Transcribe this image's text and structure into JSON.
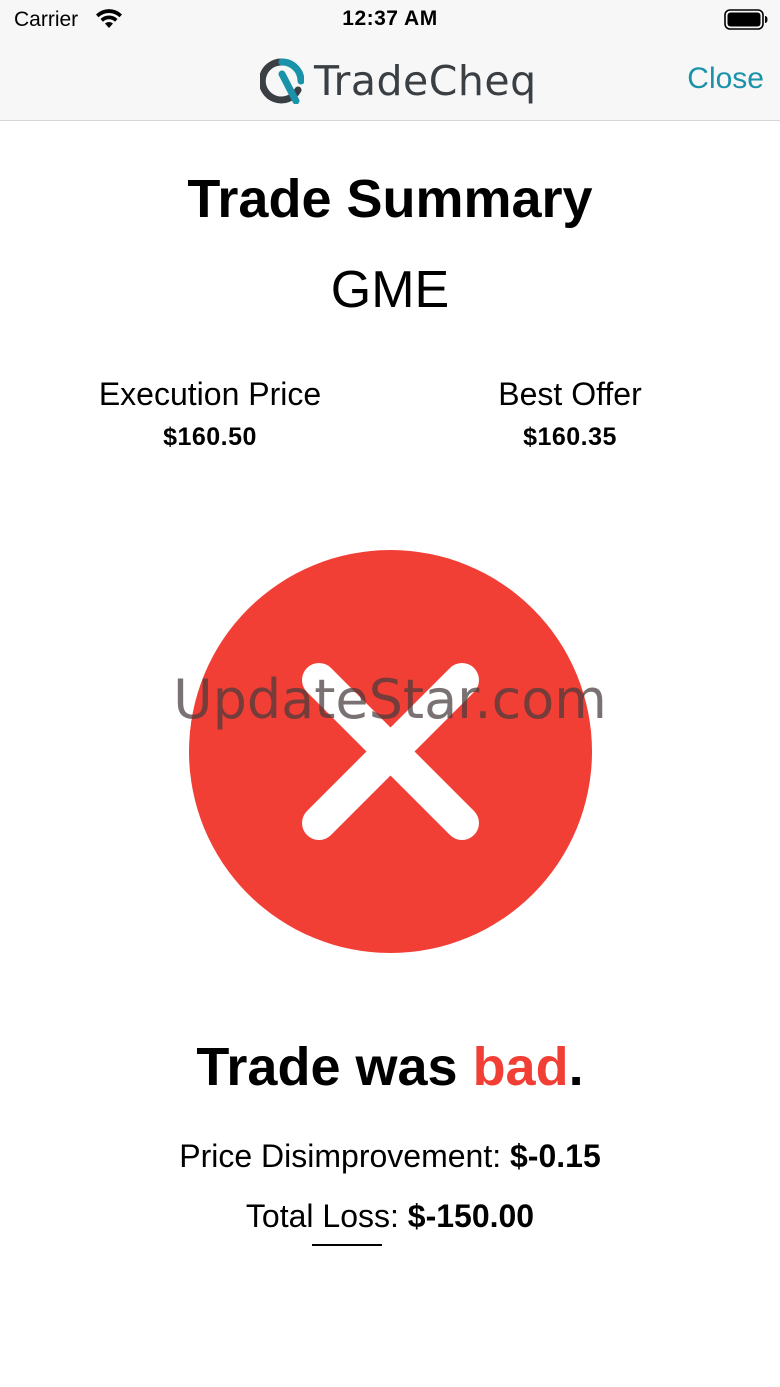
{
  "status_bar": {
    "carrier": "Carrier",
    "time": "12:37 AM",
    "icons": [
      "wifi-icon",
      "battery-icon"
    ]
  },
  "nav": {
    "app_name": "TradeCheq",
    "close_label": "Close",
    "accent_color": "#1a93aa",
    "logo_icon": "tradecheq-logo-icon"
  },
  "summary": {
    "title": "Trade Summary",
    "ticker": "GME",
    "execution_price_label": "Execution Price",
    "execution_price": "$160.50",
    "best_offer_label": "Best Offer",
    "best_offer": "$160.35"
  },
  "result": {
    "status_icon": "x-circle-icon",
    "status_color": "#f13f36",
    "verdict_prefix": "Trade was ",
    "verdict_word": "bad",
    "verdict_suffix": ".",
    "disimprovement_label": "Price Disimprovement: ",
    "disimprovement_value": "$-0.15",
    "total_loss_label": "Total Loss: ",
    "total_loss_value": "$-150.00"
  },
  "watermark": "UpdateStar.com"
}
